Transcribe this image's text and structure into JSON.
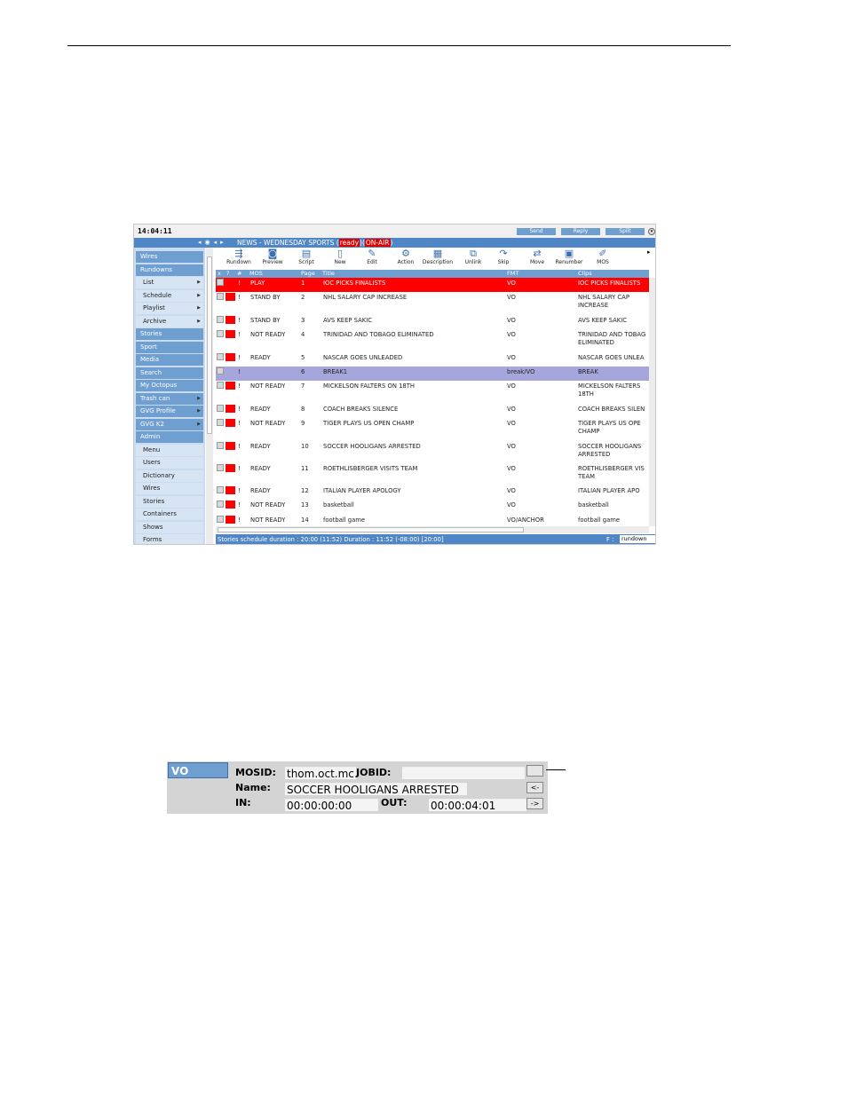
{
  "app": {
    "clock": "14:04:11",
    "top_buttons": [
      "Send",
      "Reply",
      "Split"
    ],
    "title_prefix": "NEWS - WEDNESDAY SPORTS (",
    "title_ready": "ready",
    "title_mid": ")(",
    "title_onair": "ON-AIR",
    "title_suffix": ")"
  },
  "sidebar": [
    {
      "label": "Wires",
      "kind": "primary",
      "arrow": false
    },
    {
      "label": "Rundowns",
      "kind": "primary",
      "arrow": false
    },
    {
      "label": "List",
      "kind": "sub",
      "arrow": true
    },
    {
      "label": "Schedule",
      "kind": "sub",
      "arrow": true
    },
    {
      "label": "Playlist",
      "kind": "sub",
      "arrow": true
    },
    {
      "label": "Archive",
      "kind": "sub",
      "arrow": true
    },
    {
      "label": "Stories",
      "kind": "primary",
      "arrow": false
    },
    {
      "label": "Sport",
      "kind": "primary",
      "arrow": false
    },
    {
      "label": "Media",
      "kind": "primary",
      "arrow": false
    },
    {
      "label": "Search",
      "kind": "primary",
      "arrow": false
    },
    {
      "label": "My Octopus",
      "kind": "primary",
      "arrow": false
    },
    {
      "label": "Trash can",
      "kind": "primary",
      "arrow": true
    },
    {
      "label": "GVG Profile",
      "kind": "primary",
      "arrow": true
    },
    {
      "label": "GVG K2",
      "kind": "primary",
      "arrow": true
    },
    {
      "label": "Admin",
      "kind": "primary",
      "arrow": false
    },
    {
      "label": "Menu",
      "kind": "sub",
      "arrow": false
    },
    {
      "label": "Users",
      "kind": "sub",
      "arrow": false
    },
    {
      "label": "Dictionary",
      "kind": "sub",
      "arrow": false
    },
    {
      "label": "Wires",
      "kind": "sub",
      "arrow": false
    },
    {
      "label": "Stories",
      "kind": "sub",
      "arrow": false
    },
    {
      "label": "Containers",
      "kind": "sub",
      "arrow": false
    },
    {
      "label": "Shows",
      "kind": "sub",
      "arrow": false
    },
    {
      "label": "Forms",
      "kind": "sub",
      "arrow": false
    }
  ],
  "toolbar": [
    {
      "label": "Rundown",
      "icon": "rundown-icon",
      "glyph": "⇶"
    },
    {
      "label": "Preview",
      "icon": "preview-icon",
      "glyph": "◙"
    },
    {
      "label": "Script",
      "icon": "script-icon",
      "glyph": "▤"
    },
    {
      "label": "New",
      "icon": "new-icon",
      "glyph": "▯"
    },
    {
      "label": "Edit",
      "icon": "edit-icon",
      "glyph": "✎"
    },
    {
      "label": "Action",
      "icon": "action-icon",
      "glyph": "⚙"
    },
    {
      "label": "Description",
      "icon": "description-icon",
      "glyph": "▦"
    },
    {
      "label": "Unlink",
      "icon": "unlink-icon",
      "glyph": "⧉"
    },
    {
      "label": "Skip",
      "icon": "skip-icon",
      "glyph": "↷"
    },
    {
      "label": "Move",
      "icon": "move-icon",
      "glyph": "⇄"
    },
    {
      "label": "Renumber",
      "icon": "renumber-icon",
      "glyph": "▣"
    },
    {
      "label": "MOS",
      "icon": "mos-icon",
      "glyph": "✐"
    }
  ],
  "columns": [
    "x",
    "?",
    "#",
    "MOS",
    "Page",
    "Title",
    "FMT",
    "Clips"
  ],
  "rows": [
    {
      "flag": "!",
      "mos": "PLAY",
      "page": "1",
      "title": "IOC PICKS FINALISTS",
      "fmt": "VO",
      "clips": "IOC PICKS FINALISTS",
      "style": "play",
      "h": 16
    },
    {
      "flag": "!",
      "mos": "STAND BY",
      "page": "2",
      "title": "NHL SALARY CAP INCREASE",
      "fmt": "VO",
      "clips": "NHL SALARY CAP INCREASE",
      "style": "",
      "h": 26
    },
    {
      "flag": "!",
      "mos": "STAND BY",
      "page": "3",
      "title": "AVS KEEP SAKIC",
      "fmt": "VO",
      "clips": "AVS KEEP SAKIC",
      "style": "",
      "h": 16
    },
    {
      "flag": "!",
      "mos": "NOT READY",
      "page": "4",
      "title": "TRINIDAD AND TOBAGO ELIMINATED",
      "fmt": "VO",
      "clips": "TRINIDAD AND TOBAG ELIMINATED",
      "style": "",
      "h": 26
    },
    {
      "flag": "!",
      "mos": "READY",
      "page": "5",
      "title": "NASCAR GOES UNLEADED",
      "fmt": "VO",
      "clips": "NASCAR GOES UNLEA",
      "style": "",
      "h": 16
    },
    {
      "flag": "!",
      "mos": "",
      "page": "6",
      "title": "BREAK1",
      "fmt": "break/VO",
      "clips": "BREAK",
      "style": "brk",
      "h": 16
    },
    {
      "flag": "!",
      "mos": "NOT READY",
      "page": "7",
      "title": "MICKELSON FALTERS ON 18TH",
      "fmt": "VO",
      "clips": "MICKELSON FALTERS 18TH",
      "style": "",
      "h": 26
    },
    {
      "flag": "!",
      "mos": "READY",
      "page": "8",
      "title": "COACH BREAKS SILENCE",
      "fmt": "VO",
      "clips": "COACH BREAKS SILEN",
      "style": "",
      "h": 16
    },
    {
      "flag": "!",
      "mos": "NOT READY",
      "page": "9",
      "title": "TIGER PLAYS US OPEN CHAMP",
      "fmt": "VO",
      "clips": "TIGER PLAYS US OPE CHAMP",
      "style": "",
      "h": 26
    },
    {
      "flag": "!",
      "mos": "READY",
      "page": "10",
      "title": "SOCCER HOOLIGANS ARRESTED",
      "fmt": "VO",
      "clips": "SOCCER HOOLIGANS ARRESTED",
      "style": "",
      "h": 25
    },
    {
      "flag": "!",
      "mos": "READY",
      "page": "11",
      "title": "ROETHLISBERGER VISITS TEAM",
      "fmt": "VO",
      "clips": "ROETHLISBERGER VIS TEAM",
      "style": "",
      "h": 25
    },
    {
      "flag": "!",
      "mos": "READY",
      "page": "12",
      "title": "ITALIAN PLAYER APOLOGY",
      "fmt": "VO",
      "clips": "ITALIAN PLAYER APO",
      "style": "",
      "h": 16
    },
    {
      "flag": "!",
      "mos": "NOT READY",
      "page": "13",
      "title": "basketball",
      "fmt": "VO",
      "clips": "basketball",
      "style": "",
      "h": 17
    },
    {
      "flag": "!",
      "mos": "NOT READY",
      "page": "14",
      "title": "football game",
      "fmt": "VO/ANCHOR",
      "clips": "football game",
      "style": "",
      "h": 16
    }
  ],
  "status": {
    "text": "Stories schedule duration : 20:00 (11:52) Duration : 11:52 (-08:00) [20:00]",
    "f_label": "F :",
    "view": "rundown"
  },
  "vo_panel": {
    "tab": "VO",
    "mosid_label": "MOSID:",
    "mosid_value": "thom.oct.mc",
    "jobid_label": "JOBID:",
    "jobid_value": "",
    "name_label": "Name:",
    "name_value": "SOCCER HOOLIGANS ARRESTED",
    "in_label": "IN:",
    "in_value": "00:00:00:00",
    "out_label": "OUT:",
    "out_value": "00:00:04:01",
    "btn_prev": "<-",
    "btn_next": "->",
    "btn_top": ""
  }
}
